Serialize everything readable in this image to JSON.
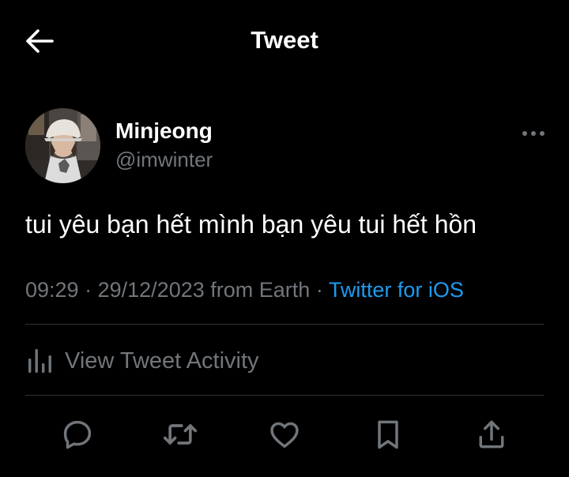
{
  "header": {
    "title": "Tweet",
    "back_icon": "back-arrow-icon"
  },
  "author": {
    "display_name": "Minjeong",
    "handle": "@imwinter"
  },
  "tweet": {
    "text": "tui yêu bạn hết mình bạn yêu tui hết hồn",
    "time": "09:29",
    "date": "29/12/2023",
    "location": "from Earth",
    "separator": "·",
    "source": "Twitter for iOS"
  },
  "activity": {
    "label": "View Tweet Activity",
    "icon": "analytics-icon"
  },
  "actions": [
    {
      "name": "reply",
      "icon": "reply-icon"
    },
    {
      "name": "retweet",
      "icon": "retweet-icon"
    },
    {
      "name": "like",
      "icon": "heart-icon"
    },
    {
      "name": "bookmark",
      "icon": "bookmark-icon"
    },
    {
      "name": "share",
      "icon": "share-icon"
    }
  ],
  "colors": {
    "background": "#000000",
    "text_primary": "#ffffff",
    "text_secondary": "#71767b",
    "link": "#1d9bf0",
    "divider": "#2f3336"
  }
}
